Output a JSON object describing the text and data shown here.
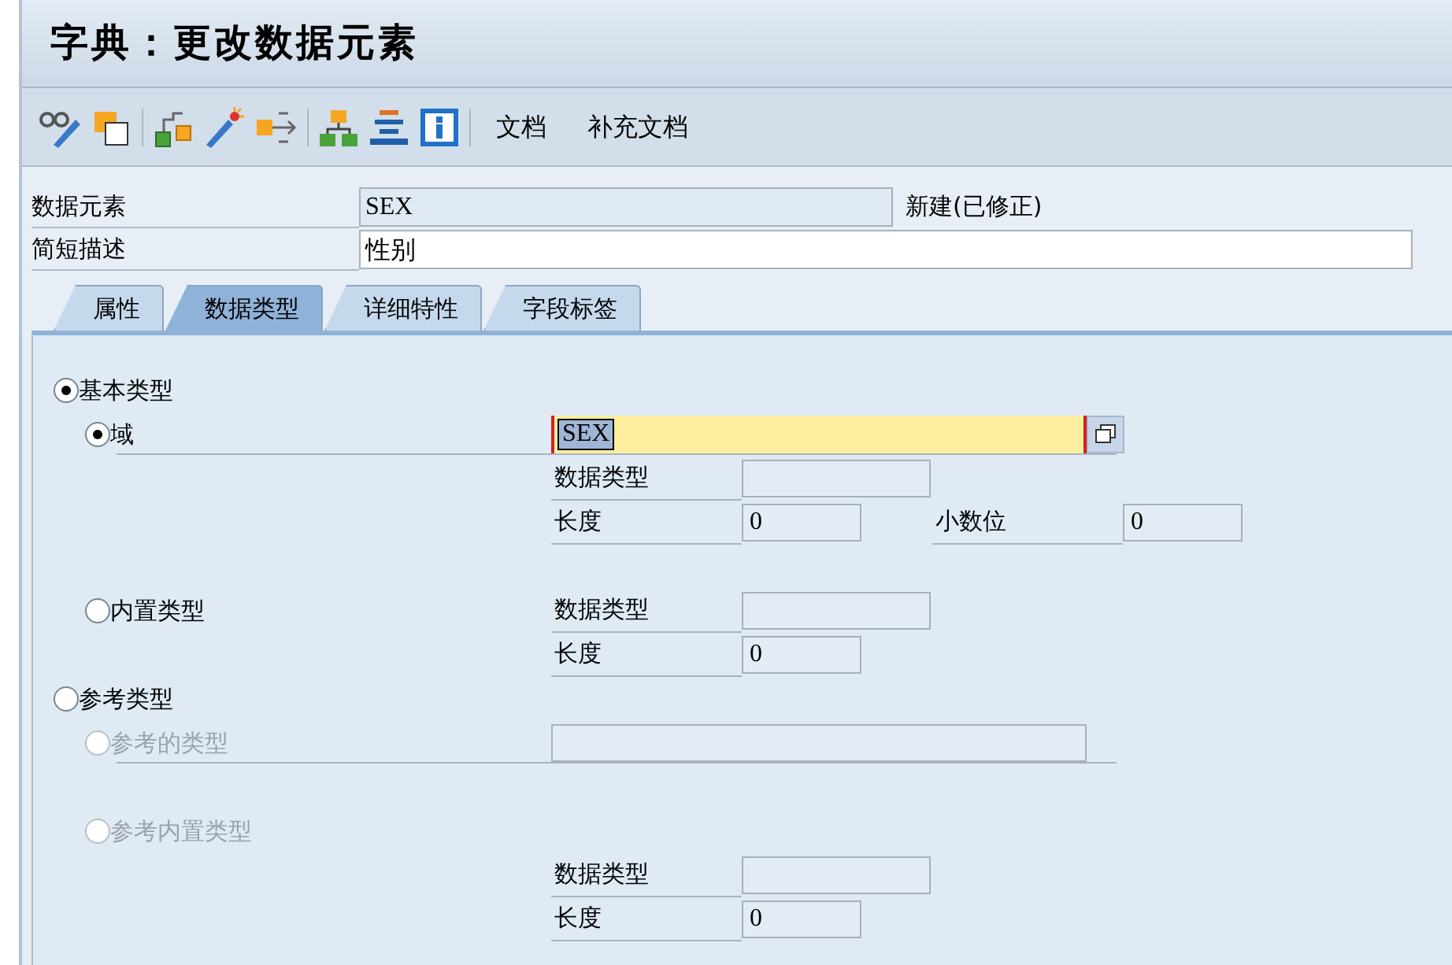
{
  "title": "字典：更改数据元素",
  "toolbar": {
    "text_buttons": [
      "文档",
      "补充文档"
    ]
  },
  "header": [
    {
      "label": "数据元素",
      "value": "SEX",
      "kind": "readonly",
      "status": "新建(已修正)"
    },
    {
      "label": "简短描述",
      "value": "性别",
      "kind": "input"
    }
  ],
  "tabs": [
    {
      "label": "属性",
      "selected": false
    },
    {
      "label": "数据类型",
      "selected": true
    },
    {
      "label": "详细特性",
      "selected": false
    },
    {
      "label": "字段标签",
      "selected": false
    }
  ],
  "type_options": [
    {
      "label": "基本类型",
      "selected": true,
      "disabled": false,
      "children": [
        {
          "label": "域",
          "selected": true,
          "disabled": false,
          "inline": {
            "kind": "domain",
            "value": "SEX"
          },
          "rows": [
            [
              {
                "label": "数据类型",
                "kind": "type"
              }
            ],
            [
              {
                "label": "长度",
                "kind": "length",
                "value": "0"
              },
              {
                "label": "小数位",
                "kind": "decimals",
                "value": "0"
              }
            ]
          ]
        },
        {
          "label": "内置类型",
          "selected": false,
          "disabled": false,
          "inline": {
            "kind": "type",
            "label": "数据类型"
          },
          "rows": [
            [
              {
                "label": "长度",
                "kind": "length",
                "value": "0"
              }
            ]
          ]
        }
      ]
    },
    {
      "label": "参考类型",
      "selected": false,
      "disabled": false,
      "children": [
        {
          "label": "参考的类型",
          "selected": false,
          "disabled": true,
          "inline": {
            "kind": "wide"
          }
        },
        {
          "label": "参考内置类型",
          "selected": false,
          "disabled": true,
          "rows": [
            [
              {
                "label": "数据类型",
                "kind": "type"
              }
            ],
            [
              {
                "label": "长度",
                "kind": "length",
                "value": "0"
              }
            ]
          ]
        }
      ]
    }
  ]
}
